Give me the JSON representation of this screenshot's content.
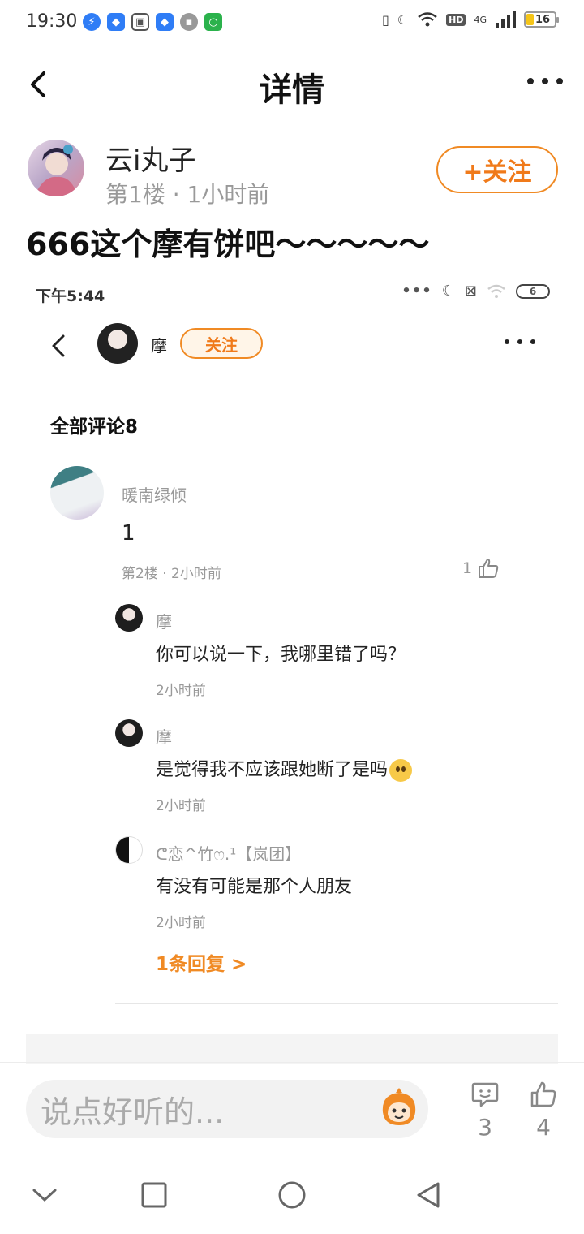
{
  "status_bar": {
    "time": "19:30",
    "network": "4G",
    "hd": "HD",
    "battery": "16"
  },
  "header": {
    "title": "详情"
  },
  "post": {
    "author": "云i丸子",
    "meta": "第1楼 · 1小时前",
    "follow_label": "+关注",
    "text": "666这个摩有饼吧～～～～～"
  },
  "embedded": {
    "status_time": "下午5:44",
    "battery": "6",
    "user": "摩",
    "follow_label": "关注",
    "comment_count": "全部评论8",
    "main_comment": {
      "author": "暖南绿倾",
      "text": "1",
      "meta": "第2楼 · 2小时前",
      "likes": "1"
    },
    "replies": [
      {
        "author": "摩",
        "text": "你可以说一下，我哪里错了吗？",
        "time": "2小时前"
      },
      {
        "author": "摩",
        "text": "是觉得我不应该跟她断了是吗",
        "time": "2小时前"
      },
      {
        "author": "ᕦ恋^竹ෆ.¹【岚团】",
        "text": "有没有可能是那个人朋友",
        "time": "2小时前"
      }
    ],
    "more_replies": "1条回复 >"
  },
  "bottom_bar": {
    "input_placeholder": "说点好听的...",
    "comment_count": "3",
    "like_count": "4"
  }
}
